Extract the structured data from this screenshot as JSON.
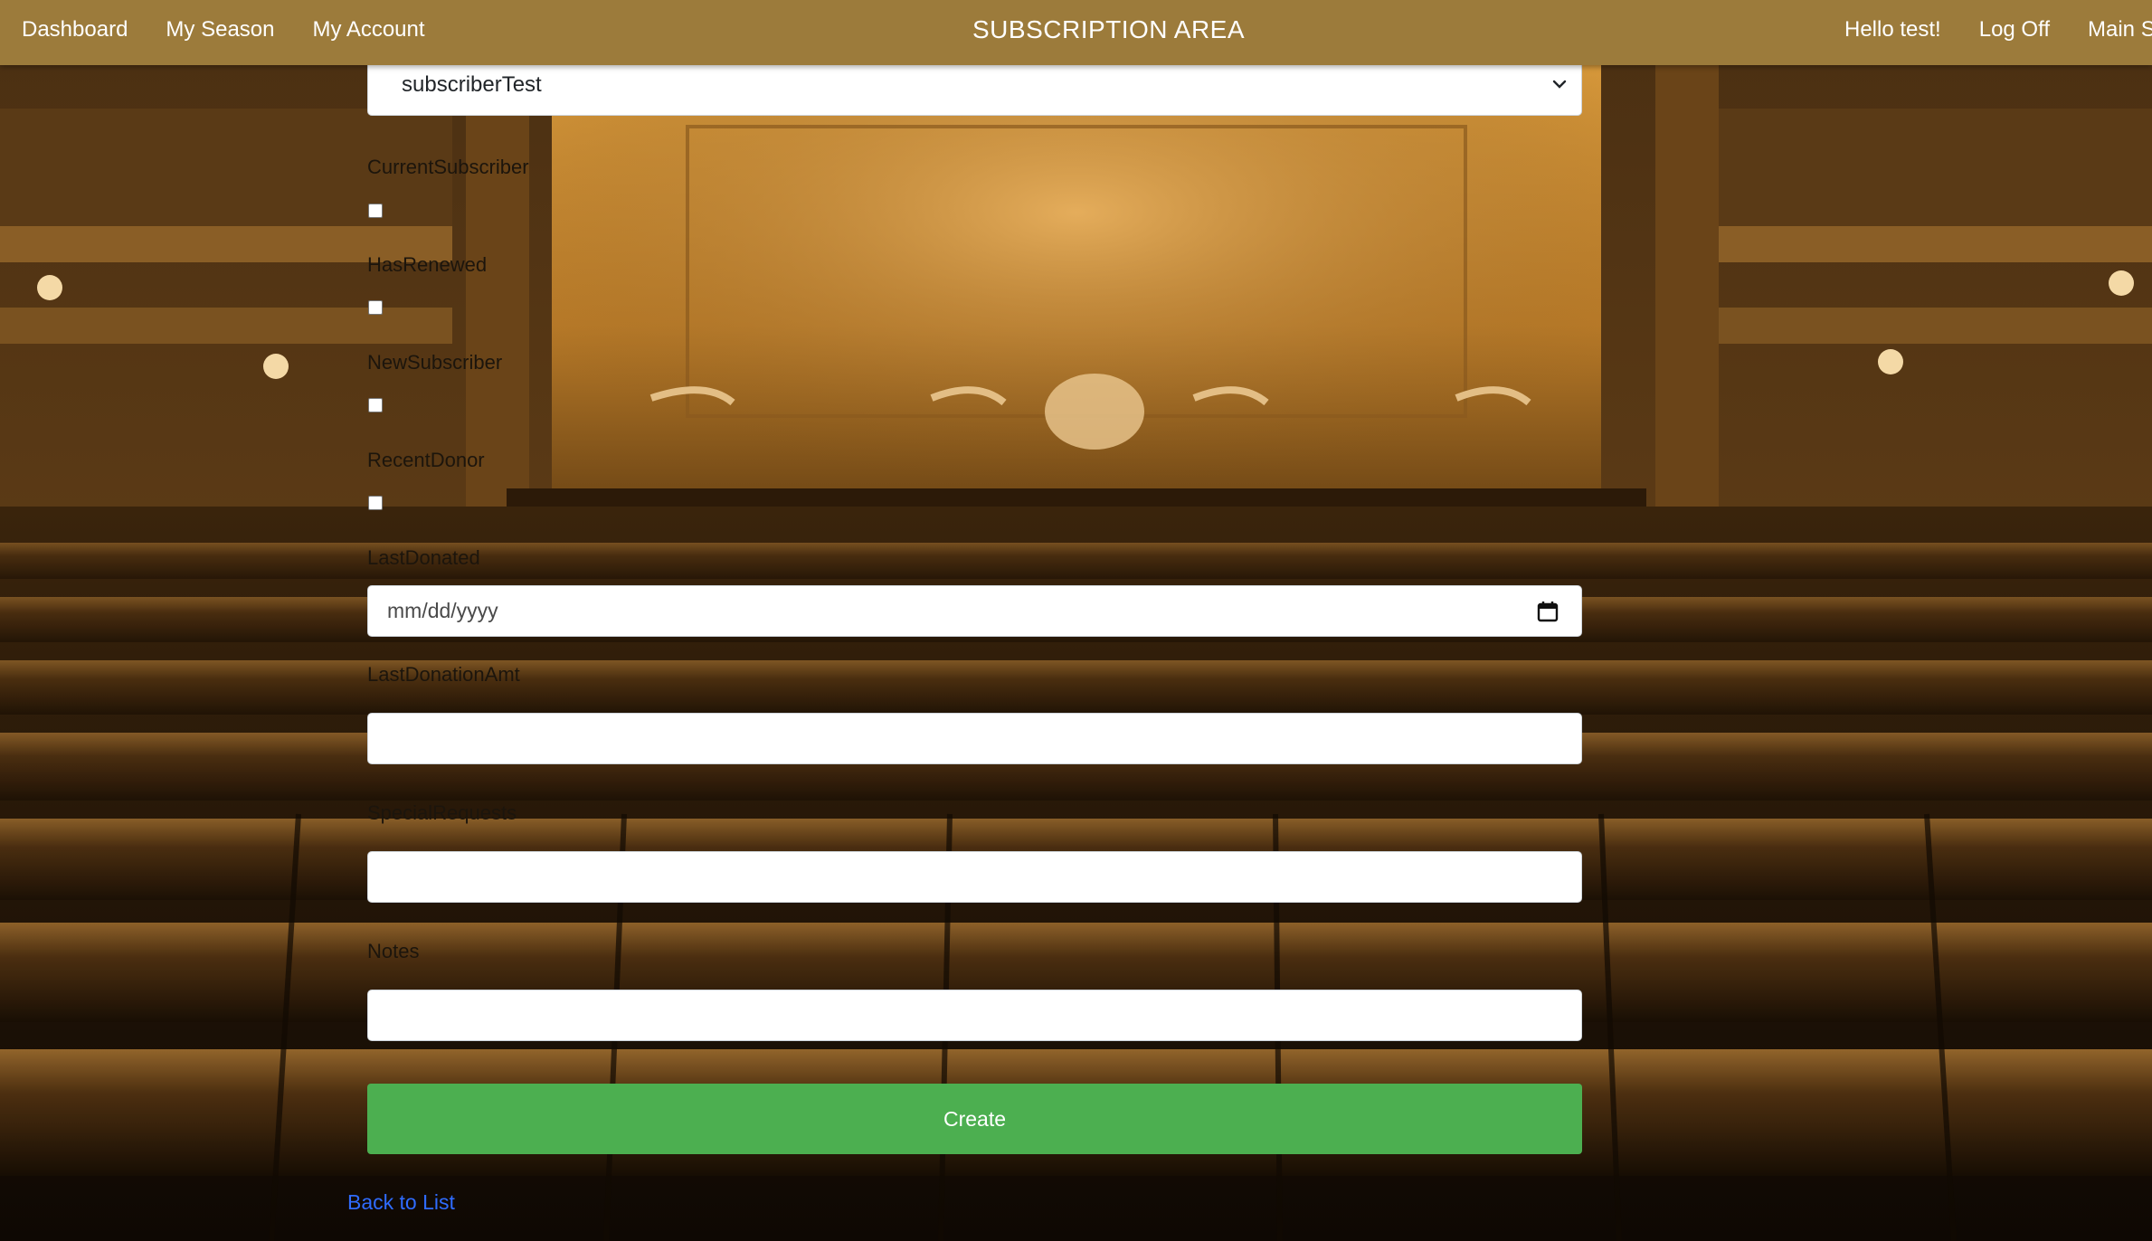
{
  "navbar": {
    "links": [
      "Dashboard",
      "My Season",
      "My Account"
    ],
    "title": "SUBSCRIPTION AREA",
    "greeting": "Hello test!",
    "logoff": "Log Off",
    "main": "Main S"
  },
  "form": {
    "subscriber_select": {
      "selected": "subscriberTest"
    },
    "fields": {
      "current_subscriber": {
        "label": "CurrentSubscriber",
        "checked": false
      },
      "has_renewed": {
        "label": "HasRenewed",
        "checked": false
      },
      "new_subscriber": {
        "label": "NewSubscriber",
        "checked": false
      },
      "recent_donor": {
        "label": "RecentDonor",
        "checked": false
      },
      "last_donated": {
        "label": "LastDonated",
        "placeholder": "mm/dd/yyyy"
      },
      "last_donation_amt": {
        "label": "LastDonationAmt",
        "value": ""
      },
      "special_requests": {
        "label": "SpecialRequests",
        "value": ""
      },
      "notes": {
        "label": "Notes",
        "value": ""
      }
    },
    "create_label": "Create",
    "back_label": "Back to List"
  },
  "colors": {
    "navbar": "#9c7b3b",
    "create_button": "#4caf50",
    "link": "#2f6cff"
  }
}
